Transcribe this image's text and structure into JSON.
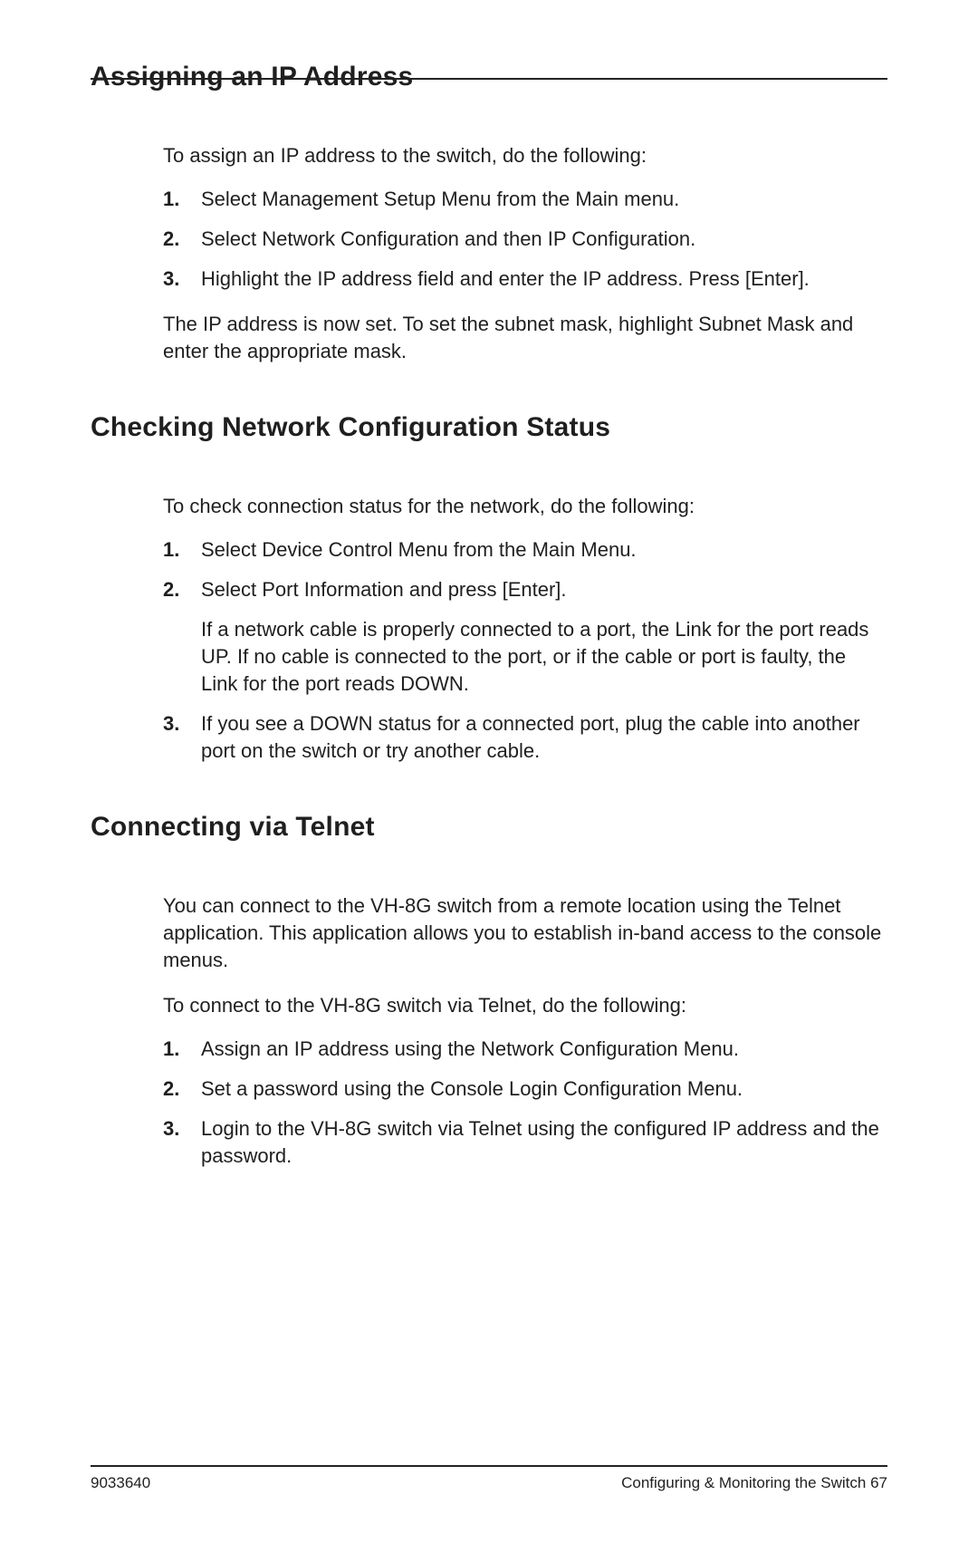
{
  "sections": [
    {
      "heading": "Assigning an IP Address",
      "intro": "To assign an IP address to the switch, do the following:",
      "steps": [
        {
          "text": "Select Management Setup Menu from the Main menu."
        },
        {
          "text": "Select Network Configuration and then IP Configuration."
        },
        {
          "text": "Highlight the IP address field and enter the IP address. Press [Enter]."
        }
      ],
      "after": "The IP address is now set. To set the subnet mask, highlight Subnet Mask and enter the appropriate mask."
    },
    {
      "heading": "Checking Network Configuration Status",
      "intro": "To check connection status for the network, do the following:",
      "steps": [
        {
          "text": "Select Device Control Menu from the Main Menu."
        },
        {
          "text": "Select Port Information and press [Enter].",
          "sub": "If a network cable is properly connected to a port, the Link for the port reads UP. If no cable is connected to the port, or if the cable or port is faulty, the Link for the port reads DOWN."
        },
        {
          "text": "If you see a DOWN status for a connected port, plug the cable into another port on the switch or try another cable."
        }
      ]
    },
    {
      "heading": "Connecting via Telnet",
      "preintro": "You can connect to the VH-8G switch from a remote location using the Telnet application. This application allows you to establish in-band access to the console menus.",
      "intro": "To connect to the VH-8G switch via Telnet, do the following:",
      "steps": [
        {
          "text": "Assign an IP address using the Network Configuration Menu."
        },
        {
          "text": "Set a password using the Console Login Configuration Menu."
        },
        {
          "text": "Login to the VH-8G switch via Telnet using the configured IP address and the password."
        }
      ]
    }
  ],
  "footer": {
    "left": "9033640",
    "right": "Configuring & Monitoring the Switch  67"
  }
}
